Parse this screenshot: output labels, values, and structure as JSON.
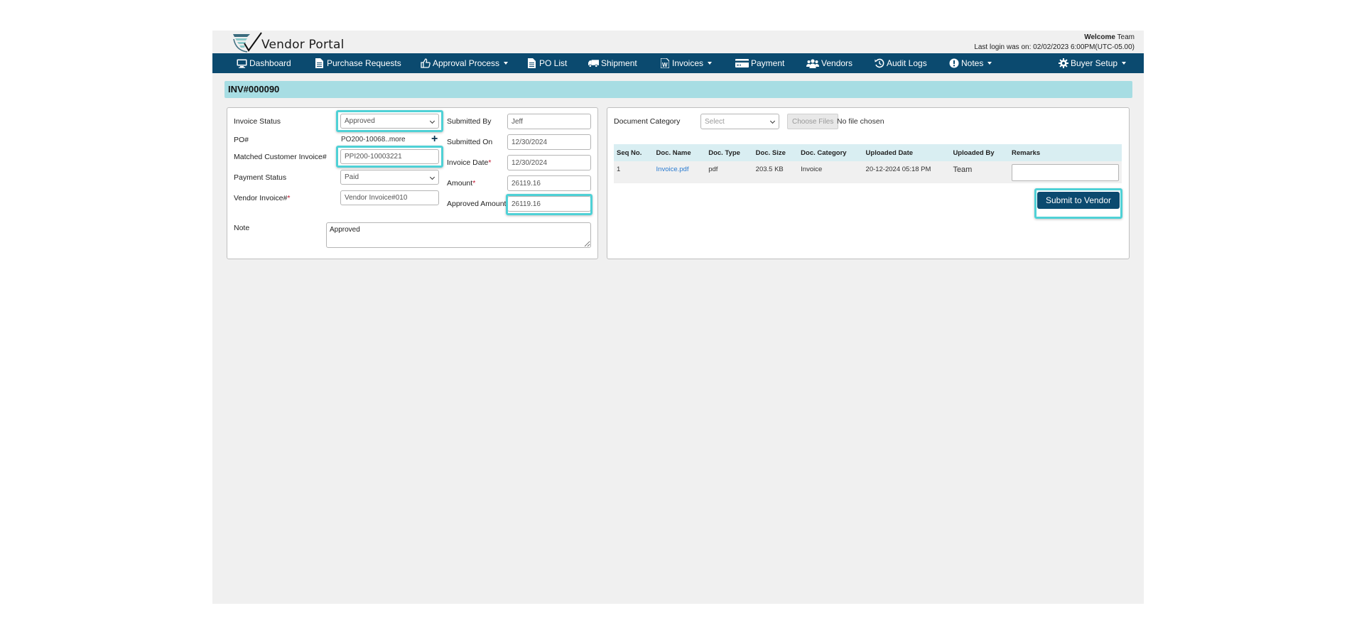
{
  "header": {
    "app_title": "Vendor Portal",
    "welcome_label": "Welcome",
    "welcome_user": "Team",
    "last_login": "Last login was on: 02/02/2023 6:00PM(UTC-05.00)"
  },
  "nav": {
    "items": [
      {
        "label": "Dashboard",
        "icon": "monitor-icon",
        "dropdown": false
      },
      {
        "label": "Purchase Requests",
        "icon": "document-icon",
        "dropdown": false
      },
      {
        "label": "Approval Process",
        "icon": "thumbs-up-icon",
        "dropdown": true
      },
      {
        "label": "PO List",
        "icon": "document-icon",
        "dropdown": false
      },
      {
        "label": "Shipment",
        "icon": "truck-icon",
        "dropdown": false
      },
      {
        "label": "Invoices",
        "icon": "word-document-icon",
        "dropdown": true
      },
      {
        "label": "Payment",
        "icon": "credit-card-icon",
        "dropdown": false
      },
      {
        "label": "Vendors",
        "icon": "users-icon",
        "dropdown": false
      },
      {
        "label": "Audit Logs",
        "icon": "history-icon",
        "dropdown": false
      },
      {
        "label": "Notes",
        "icon": "exclamation-circle-icon",
        "dropdown": true
      },
      {
        "label": "Buyer Setup",
        "icon": "gear-icon",
        "dropdown": true
      }
    ]
  },
  "page": {
    "title": "INV#000090"
  },
  "invoice_form": {
    "invoice_status": {
      "label": "Invoice Status",
      "value": "Approved"
    },
    "po": {
      "label": "PO#",
      "value": "PO200-10068..more"
    },
    "matched_customer_invoice": {
      "label": "Matched Customer Invoice#",
      "value": "PPI200-10003221"
    },
    "payment_status": {
      "label": "Payment Status",
      "value": "Paid"
    },
    "vendor_invoice": {
      "label": "Vendor Invoice#",
      "required_mark": "*",
      "value": "Vendor Invoice#010"
    },
    "submitted_by": {
      "label": "Submitted By",
      "value": "Jeff"
    },
    "submitted_on": {
      "label": "Submitted On",
      "value": "12/30/2024"
    },
    "invoice_date": {
      "label": "Invoice Date",
      "required_mark": "*",
      "value": "12/30/2024"
    },
    "amount": {
      "label": "Amount",
      "required_mark": "*",
      "value": "26119.16"
    },
    "approved_amount": {
      "label": "Approved Amount",
      "value": "26119.16"
    },
    "note": {
      "label": "Note",
      "value": "Approved"
    }
  },
  "documents": {
    "category_label": "Document Category",
    "category_placeholder": "Select",
    "choose_files_label": "Choose Files",
    "no_file_text": "No file chosen",
    "columns": [
      "Seq No.",
      "Doc. Name",
      "Doc. Type",
      "Doc. Size",
      "Doc. Category",
      "Uploaded Date",
      "Uploaded By",
      "Remarks"
    ],
    "rows": [
      {
        "seq": "1",
        "name": "Invoice.pdf",
        "type": "pdf",
        "size": "203.5 KB",
        "category": "Invoice",
        "uploaded_date": "20-12-2024 05:18 PM",
        "uploaded_by": "Team",
        "remarks": ""
      }
    ],
    "submit_label": "Submit to Vendor"
  },
  "colors": {
    "navbar": "#0b4a6f",
    "title_bar": "#a7dde3",
    "highlight": "#4fd1d6",
    "link": "#2a7bd0",
    "required": "#c0132c"
  }
}
